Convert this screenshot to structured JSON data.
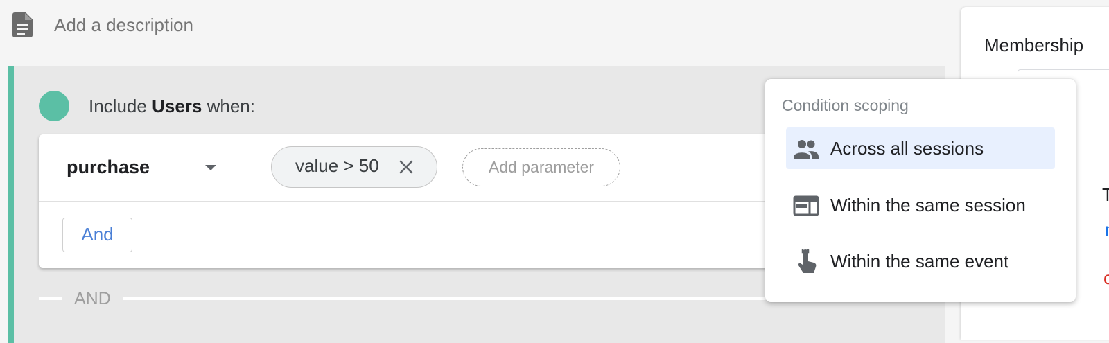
{
  "description": {
    "icon": "document-icon",
    "placeholder": "Add a description"
  },
  "group": {
    "accent_color": "#5bbfa5",
    "include_prefix": "Include",
    "scope_bold": "Users",
    "include_suffix": "when:",
    "condition": {
      "event_name": "purchase",
      "parameter_chip": "value > 50",
      "add_parameter_label": "Add parameter",
      "and_button_label": "And"
    },
    "separator_label": "AND"
  },
  "right_panel": {
    "title_fragment": "Membership",
    "fragments": [
      "m",
      "Tri",
      "n",
      "or"
    ]
  },
  "scope_menu": {
    "header": "Condition scoping",
    "items": [
      {
        "label": "Across all sessions",
        "icon": "people-icon",
        "selected": true
      },
      {
        "label": "Within the same session",
        "icon": "session-window-icon",
        "selected": false
      },
      {
        "label": "Within the same event",
        "icon": "touch-hand-icon",
        "selected": false
      }
    ],
    "selected_color": "#e8f0fe"
  }
}
